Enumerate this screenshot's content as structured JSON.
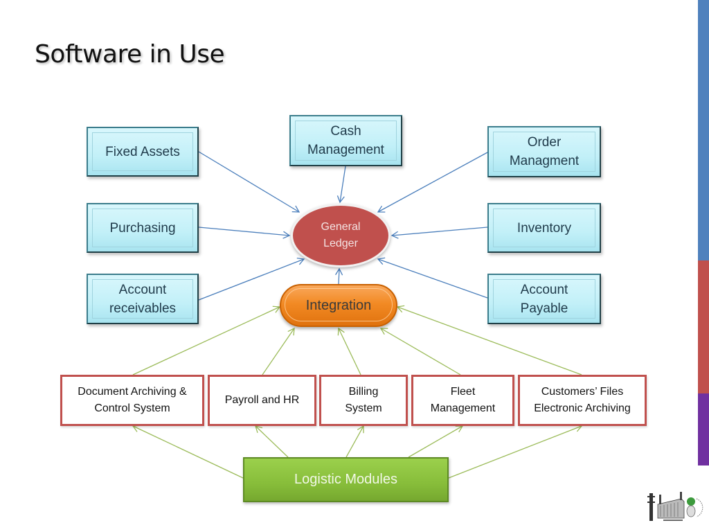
{
  "title": "Software in Use",
  "colors": {
    "accent_blue": "#4f81bd",
    "accent_red": "#c0504d",
    "accent_purple": "#7030a0",
    "module_fill": "#c2f0f8",
    "ledger_fill": "#c0504d",
    "integration_fill": "#f28a24",
    "logistic_fill": "#87bd3a",
    "blue_arrow": "#4a7ebb",
    "green_arrow": "#9bbb59"
  },
  "hub": {
    "label": "General\nLedger"
  },
  "integration": {
    "label": "Integration"
  },
  "modules": [
    {
      "id": "fixed-assets",
      "label": "Fixed Assets"
    },
    {
      "id": "cash-management",
      "label": "Cash\nManagement"
    },
    {
      "id": "order-management",
      "label": "Order\nManagment"
    },
    {
      "id": "purchasing",
      "label": "Purchasing"
    },
    {
      "id": "inventory",
      "label": "Inventory"
    },
    {
      "id": "account-receivables",
      "label": "Account\nreceivables"
    },
    {
      "id": "account-payable",
      "label": "Account\nPayable"
    }
  ],
  "systems": [
    {
      "id": "document-archiving",
      "label": "Document Archiving &\nControl System"
    },
    {
      "id": "payroll-hr",
      "label": "Payroll and HR"
    },
    {
      "id": "billing-system",
      "label": "Billing\nSystem"
    },
    {
      "id": "fleet-management",
      "label": "Fleet\nManagement"
    },
    {
      "id": "customers-files",
      "label": "Customers’ Files\nElectronic Archiving"
    }
  ],
  "logistic": {
    "label": "Logistic Modules"
  },
  "edges": [
    {
      "from": "fixed-assets",
      "to": "general-ledger"
    },
    {
      "from": "cash-management",
      "to": "general-ledger"
    },
    {
      "from": "order-management",
      "to": "general-ledger"
    },
    {
      "from": "purchasing",
      "to": "general-ledger"
    },
    {
      "from": "inventory",
      "to": "general-ledger"
    },
    {
      "from": "account-receivables",
      "to": "general-ledger"
    },
    {
      "from": "account-payable",
      "to": "general-ledger"
    },
    {
      "from": "integration",
      "to": "general-ledger"
    },
    {
      "from": "document-archiving",
      "to": "integration"
    },
    {
      "from": "payroll-hr",
      "to": "integration"
    },
    {
      "from": "billing-system",
      "to": "integration"
    },
    {
      "from": "fleet-management",
      "to": "integration"
    },
    {
      "from": "customers-files",
      "to": "integration"
    },
    {
      "from": "logistic-modules",
      "to": "document-archiving"
    },
    {
      "from": "logistic-modules",
      "to": "payroll-hr"
    },
    {
      "from": "logistic-modules",
      "to": "billing-system"
    },
    {
      "from": "logistic-modules",
      "to": "fleet-management"
    },
    {
      "from": "logistic-modules",
      "to": "customers-files"
    }
  ]
}
